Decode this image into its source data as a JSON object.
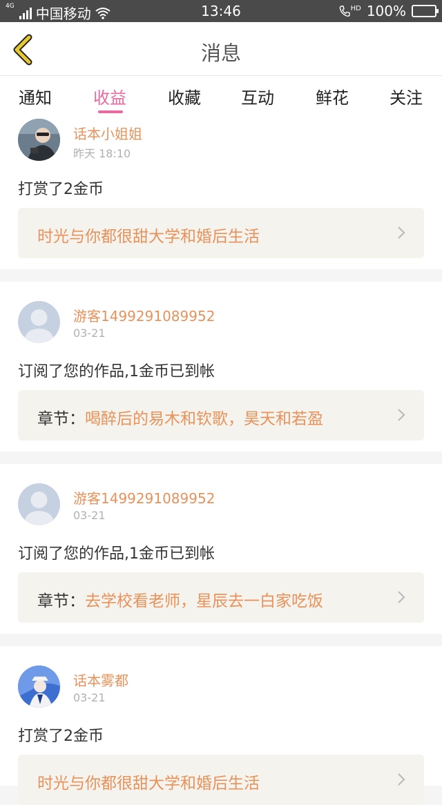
{
  "status": {
    "carrier": "中国移动",
    "network": "4G",
    "time": "13:46",
    "battery": "100%",
    "hd": "HD"
  },
  "nav": {
    "title": "消息",
    "back_icon": "chevron-left-icon"
  },
  "tabs": [
    {
      "label": "通知",
      "active": false
    },
    {
      "label": "收益",
      "active": true
    },
    {
      "label": "收藏",
      "active": false
    },
    {
      "label": "互动",
      "active": false
    },
    {
      "label": "鲜花",
      "active": false
    },
    {
      "label": "关注",
      "active": false
    }
  ],
  "messages": [
    {
      "user": "话本小姐姐",
      "time": "昨天 18:10",
      "text": "打赏了2金币",
      "link_prefix": "",
      "link": "时光与你都很甜大学和婚后生活"
    },
    {
      "user": "游客1499291089952",
      "time": "03-21",
      "text": "订阅了您的作品,1金币已到帐",
      "link_prefix": "章节：",
      "link": "喝醉后的易木和钦歌，昊天和若盈"
    },
    {
      "user": "游客1499291089952",
      "time": "03-21",
      "text": "订阅了您的作品,1金币已到帐",
      "link_prefix": "章节：",
      "link": "去学校看老师，星辰去一白家吃饭"
    },
    {
      "user": "话本雾都",
      "time": "03-21",
      "text": "打赏了2金币",
      "link_prefix": "",
      "link": "时光与你都很甜大学和婚后生活"
    }
  ],
  "colors": {
    "accent": "#e86aa0",
    "name": "#e8925a",
    "back": "#e8c830"
  }
}
